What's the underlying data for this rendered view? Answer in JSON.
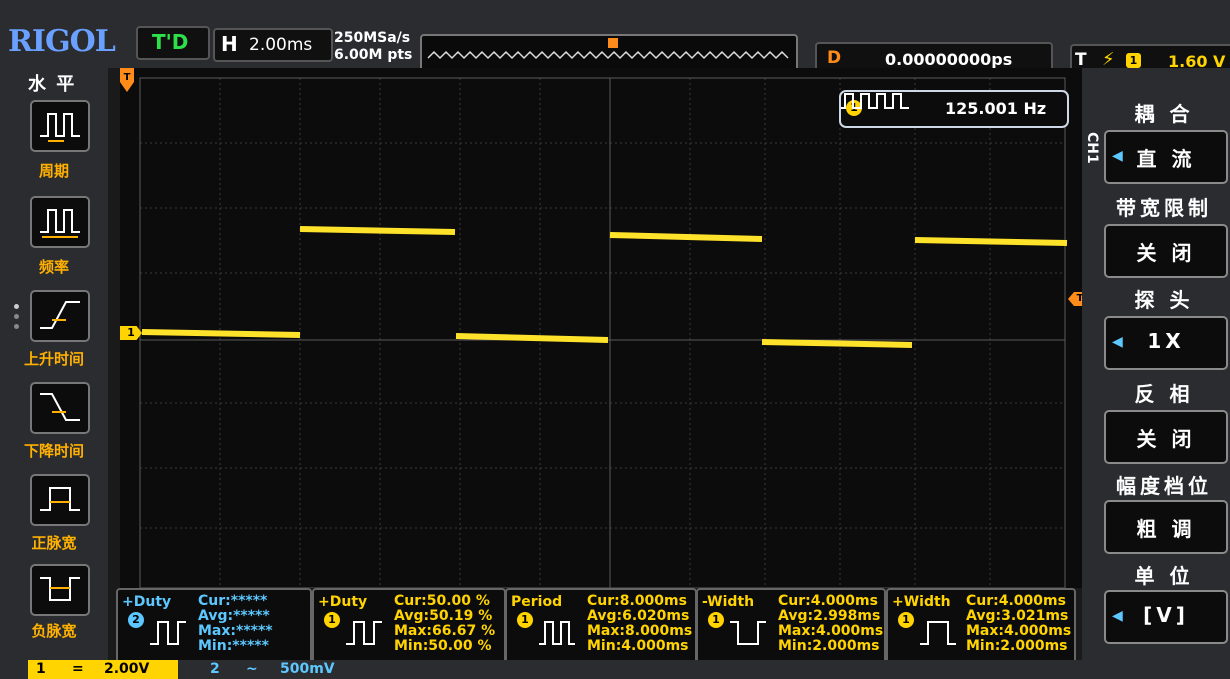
{
  "brand": "RIGOL",
  "status": {
    "run_state": "T'D"
  },
  "timebase": {
    "label": "H",
    "value": "2.00ms"
  },
  "acquisition": {
    "sample_rate": "250MSa/s",
    "memory_depth": "6.00M pts"
  },
  "delay": {
    "label": "D",
    "value": "0.00000000ps"
  },
  "trigger": {
    "label": "T",
    "edge_icon": "rising-edge-icon",
    "channel": "1",
    "level": "1.60 V"
  },
  "frequency": {
    "channel": "1",
    "value": "125.001 Hz"
  },
  "left_menu": {
    "title": "水 平",
    "items": [
      {
        "label": "周期",
        "icon": "period-icon"
      },
      {
        "label": "频率",
        "icon": "frequency-icon"
      },
      {
        "label": "上升时间",
        "icon": "rise-time-icon"
      },
      {
        "label": "下降时间",
        "icon": "fall-time-icon"
      },
      {
        "label": "正脉宽",
        "icon": "positive-width-icon"
      },
      {
        "label": "负脉宽",
        "icon": "negative-width-icon"
      }
    ]
  },
  "right_menu": {
    "channel_tag": "CH1",
    "sections": [
      {
        "heading": "耦 合",
        "value": "直 流"
      },
      {
        "heading": "带宽限制",
        "value": "关 闭"
      },
      {
        "heading": "探 头",
        "value": "1X"
      },
      {
        "heading": "反 相",
        "value": "关 闭"
      },
      {
        "heading": "幅度档位",
        "value": "粗 调"
      },
      {
        "heading": "单 位",
        "value": "[V]"
      }
    ]
  },
  "markers": {
    "trigger_position": "T",
    "trigger_level": "T",
    "ch1_ground": "1"
  },
  "measurements": [
    {
      "name": "+Duty",
      "channel": "2",
      "cur": "Cur:*****",
      "avg": "Avg:*****",
      "max": "Max:*****",
      "min": "Min:*****"
    },
    {
      "name": "+Duty",
      "channel": "1",
      "cur": "Cur:50.00 %",
      "avg": "Avg:50.19 %",
      "max": "Max:66.67 %",
      "min": "Min:50.00 %"
    },
    {
      "name": "Period",
      "channel": "1",
      "cur": "Cur:8.000ms",
      "avg": "Avg:6.020ms",
      "max": "Max:8.000ms",
      "min": "Min:4.000ms"
    },
    {
      "name": "-Width",
      "channel": "1",
      "cur": "Cur:4.000ms",
      "avg": "Avg:2.998ms",
      "max": "Max:4.000ms",
      "min": "Min:2.000ms"
    },
    {
      "name": "+Width",
      "channel": "1",
      "cur": "Cur:4.000ms",
      "avg": "Avg:3.021ms",
      "max": "Max:4.000ms",
      "min": "Min:2.000ms"
    }
  ],
  "bottom_strip": {
    "ch1": {
      "num": "1",
      "coupling": "=",
      "scale": "2.00V"
    },
    "ch2": {
      "num": "2",
      "coupling": "~",
      "scale": "500mV"
    }
  },
  "colors": {
    "ch1": "#ffd400",
    "ch2": "#5cc8ff",
    "accent": "#ff8c1a",
    "menu_label": "#ffb000"
  }
}
